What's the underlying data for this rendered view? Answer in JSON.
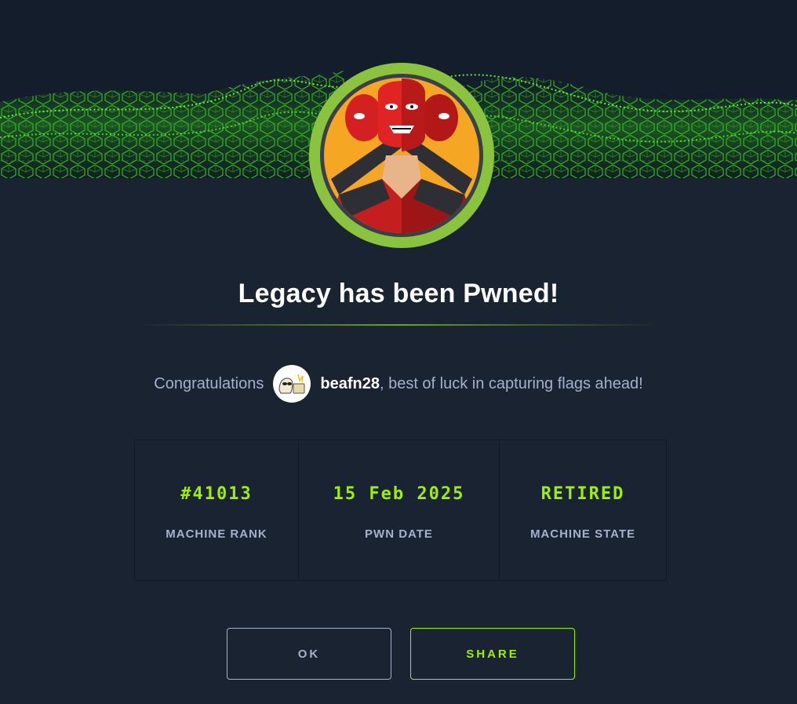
{
  "header": {
    "banner_image": "green-wireframe-cube-waves",
    "machine_avatar": "red-three-headed-hero-icon"
  },
  "title": "Legacy has been Pwned!",
  "congrats": {
    "prefix": "Congratulations",
    "user_avatar": "user-avatar-icon",
    "username": "beafn28",
    "suffix": ", best of luck in capturing flags ahead!"
  },
  "stats": [
    {
      "value": "#41013",
      "label": "MACHINE RANK"
    },
    {
      "value": "15 Feb 2025",
      "label": "PWN DATE"
    },
    {
      "value": "RETIRED",
      "label": "MACHINE STATE"
    }
  ],
  "buttons": {
    "ok": "OK",
    "share": "SHARE"
  },
  "colors": {
    "background": "#1a2332",
    "accent_green": "#9fef00",
    "muted_text": "#a4b1cd",
    "avatar_ring": "#8ac43f"
  }
}
